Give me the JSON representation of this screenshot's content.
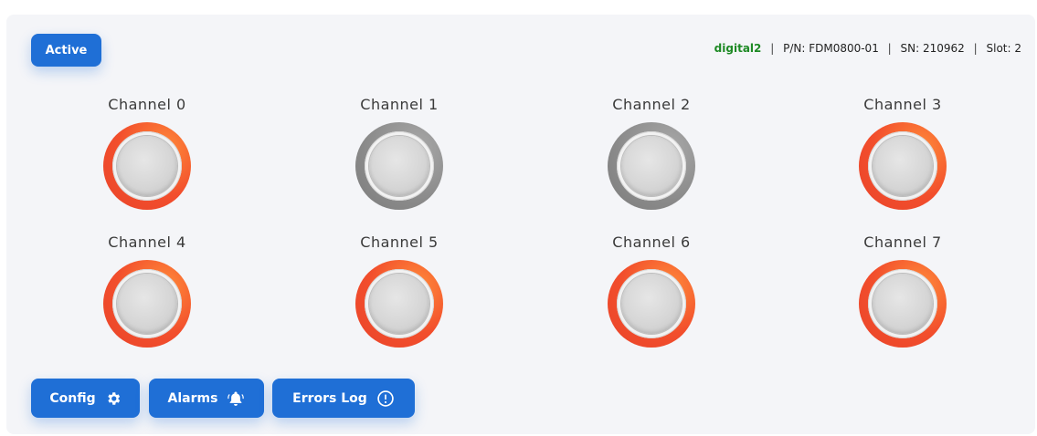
{
  "status_button": {
    "label": "Active"
  },
  "device_info": {
    "name": "digital2",
    "part_number": "P/N: FDM0800-01",
    "serial_number": "SN: 210962",
    "slot": "Slot: 2",
    "separator": "|",
    "name_color": "#1e8a25"
  },
  "channels": [
    {
      "label": "Channel 0",
      "state": "alarm"
    },
    {
      "label": "Channel 1",
      "state": "off"
    },
    {
      "label": "Channel 2",
      "state": "off"
    },
    {
      "label": "Channel 3",
      "state": "alarm"
    },
    {
      "label": "Channel 4",
      "state": "alarm"
    },
    {
      "label": "Channel 5",
      "state": "alarm"
    },
    {
      "label": "Channel 6",
      "state": "alarm"
    },
    {
      "label": "Channel 7",
      "state": "alarm"
    }
  ],
  "actions": {
    "config": {
      "label": "Config",
      "icon": "gear-icon"
    },
    "alarms": {
      "label": "Alarms",
      "icon": "bell-icon"
    },
    "errors_log": {
      "label": "Errors Log",
      "icon": "exclamation-circle-icon"
    }
  },
  "colors": {
    "accent": "#1f6fd6",
    "alarm": "#f24e2c",
    "off": "#8a8a8a"
  }
}
